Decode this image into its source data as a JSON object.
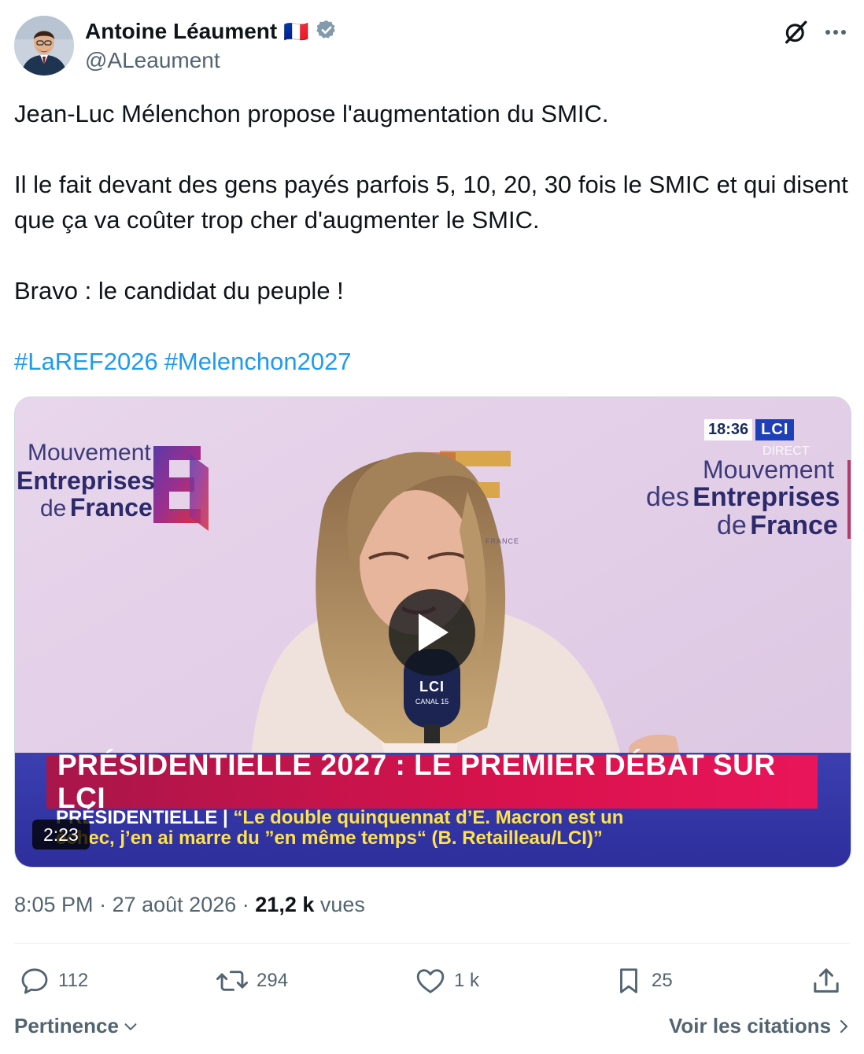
{
  "author": {
    "name": "Antoine Léaument",
    "flag": "🇫🇷",
    "handle": "@ALeaument",
    "verified_color": "#829aab"
  },
  "tweet": {
    "paragraphs": [
      "Jean-Luc Mélenchon propose l'augmentation du SMIC.",
      "Il le fait devant des gens payés parfois 5, 10, 20, 30 fois le SMIC et qui disent que ça va coûter trop cher d'augmenter le SMIC.",
      "Bravo : le candidat du peuple !"
    ],
    "hashtags": [
      "#LaREF2026",
      "#Melenchon2027"
    ]
  },
  "video": {
    "duration": "2:23",
    "logo_left": {
      "line1": "Mouvement",
      "line2": "Entreprises",
      "line3a": "de",
      "line3b": "France"
    },
    "logo_right": {
      "line1": "Mouvement",
      "line2a": "des",
      "line2b": "Entreprises",
      "line3a": "de",
      "line3b": "France"
    },
    "clock": "18:36",
    "channel": "LCI",
    "live_label": "DIRECT",
    "mic_label": "LCI",
    "mic_sub": "CANAL 15",
    "ref_small": "FRANCE",
    "headline": "PRÉSIDENTIELLE 2027 : LE PREMIER DÉBAT SUR LCI",
    "sub_lead": "PRÉSIDENTIELLE |",
    "sub_line1": "“Le double quinquennat d’E. Macron est un",
    "sub_line2": "échec, j’en ai marre du ”en même temps“ (B. Retailleau/LCI)”"
  },
  "meta": {
    "time": "8:05 PM",
    "sep": "·",
    "date": "27 août 2026",
    "views_count": "21,2 k",
    "views_label": "vues"
  },
  "actions": {
    "replies": "112",
    "reposts": "294",
    "likes": "1 k",
    "bookmarks": "25"
  },
  "footer": {
    "sort": "Pertinence",
    "quotes": "Voir les citations"
  },
  "colors": {
    "link": "#1d9bf0",
    "secondary": "#536471",
    "headline_bg": "#d8124c",
    "chyron_bg": "#2e2e9c"
  }
}
